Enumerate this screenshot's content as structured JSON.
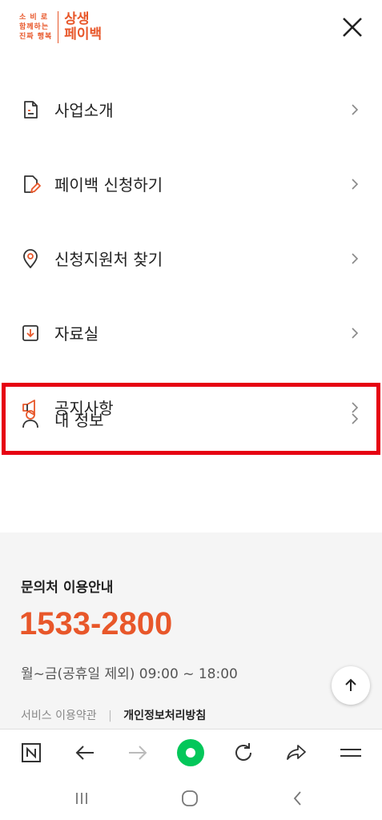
{
  "header": {
    "logo_small_lines": [
      "소 비 로",
      "함께하는",
      "진짜 행복"
    ],
    "logo_big_lines": [
      "상생",
      "페이백"
    ],
    "close_label": "close"
  },
  "menu": {
    "items": [
      {
        "label": "사업소개",
        "icon": "document-icon"
      },
      {
        "label": "페이백 신청하기",
        "icon": "edit-document-icon"
      },
      {
        "label": "신청지원처 찾기",
        "icon": "location-pin-icon"
      },
      {
        "label": "자료실",
        "icon": "download-box-icon"
      },
      {
        "label": "공지사항",
        "icon": "megaphone-icon"
      },
      {
        "label": "내 정보",
        "icon": "person-icon"
      }
    ]
  },
  "info": {
    "title": "문의처 이용안내",
    "phone": "1533-2800",
    "hours": "월~금(공휴일 제외) 09:00 ~ 18:00",
    "link_terms": "서비스 이용약관",
    "link_privacy": "개인정보처리방침"
  },
  "colors": {
    "accent": "#e8572a",
    "highlight": "#e60012",
    "toolbar_green": "#03c75a"
  }
}
